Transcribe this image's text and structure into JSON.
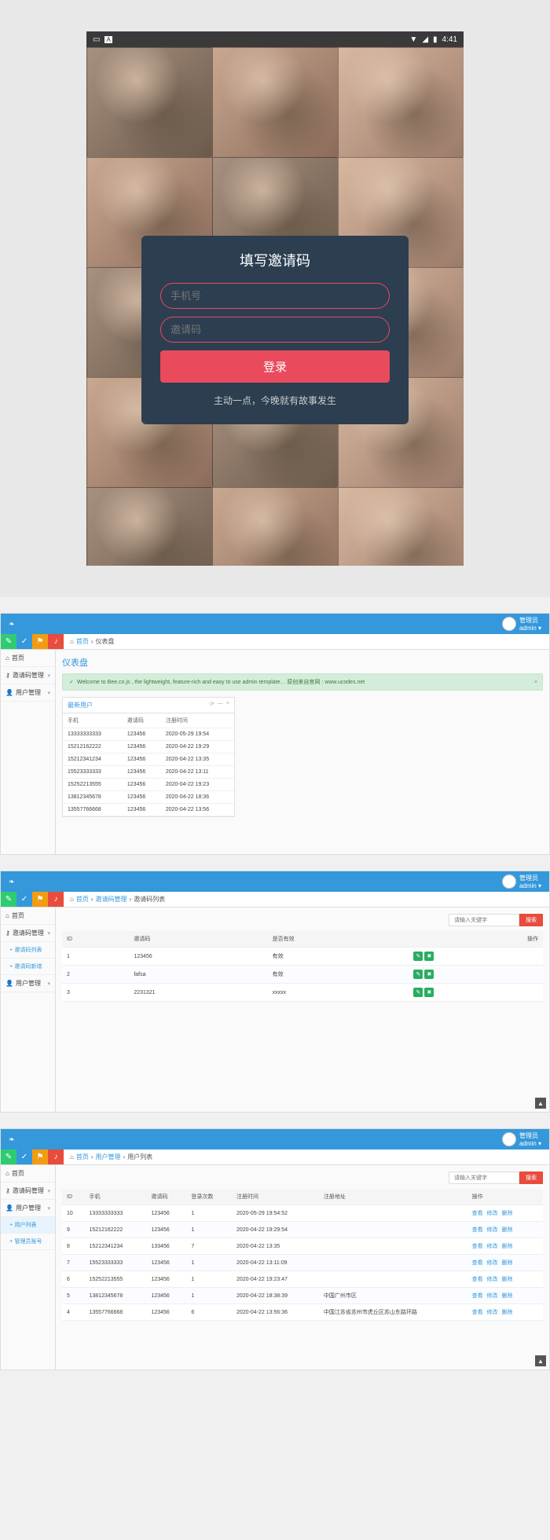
{
  "mobile": {
    "status_time": "4:41",
    "login_title": "填写邀请码",
    "phone_placeholder": "手机号",
    "code_placeholder": "邀请码",
    "login_btn": "登录",
    "tagline": "主动一点，今晚就有故事发生"
  },
  "panel1": {
    "user_label": "管理员\nadmin",
    "breadcrumb": [
      "首页",
      "仪表盘"
    ],
    "page_title": "仪表盘",
    "alert": "Welcome to Bee.cn.js , the lightweight, feature-rich and easy to use admin template… 原创来自官网 : www.ucodes.net",
    "sidebar": [
      {
        "label": "首页",
        "icon": "home"
      },
      {
        "label": "邀请码管理",
        "icon": "code",
        "expand": true
      },
      {
        "label": "用户管理",
        "icon": "user",
        "expand": true
      }
    ],
    "card_title": "最新用户",
    "table_headers": [
      "手机",
      "邀请码",
      "注册时间"
    ],
    "rows": [
      [
        "13333333333",
        "123456",
        "2020-05-29 19:54"
      ],
      [
        "15212162222",
        "123456",
        "2020-04-22 19:29"
      ],
      [
        "15212341234",
        "123456",
        "2020-04-22 13:35"
      ],
      [
        "15523333333",
        "123456",
        "2020-04-22 13:11"
      ],
      [
        "15252213555",
        "123456",
        "2020-04-22 19:23"
      ],
      [
        "13812345678",
        "123456",
        "2020-04-22 18:36"
      ],
      [
        "13557766668",
        "123456",
        "2020-04-22 13:56"
      ]
    ]
  },
  "panel2": {
    "breadcrumb": [
      "首页",
      "邀请码管理",
      "邀请码列表"
    ],
    "search_placeholder": "请输入关键字",
    "search_btn": "搜索",
    "sidebar": [
      {
        "label": "首页",
        "icon": "home"
      },
      {
        "label": "邀请码管理",
        "icon": "code",
        "expand": true
      },
      {
        "label": "邀请码列表",
        "sub": true
      },
      {
        "label": "邀请码新增",
        "sub": true
      },
      {
        "label": "用户管理",
        "icon": "user",
        "expand": true
      }
    ],
    "table_headers": [
      "ID",
      "邀请码",
      "是否有效",
      "操作"
    ],
    "rows": [
      {
        "id": "1",
        "code": "123456",
        "valid": "有效",
        "ops": true
      },
      {
        "id": "2",
        "code": "fafsa",
        "valid": "有效",
        "ops": true
      },
      {
        "id": "3",
        "code": "2231321",
        "valid": "xxxxx",
        "ops": true
      }
    ]
  },
  "panel3": {
    "breadcrumb": [
      "首页",
      "用户管理",
      "用户列表"
    ],
    "search_placeholder": "请输入关键字",
    "search_btn": "搜索",
    "sidebar": [
      {
        "label": "首页",
        "icon": "home"
      },
      {
        "label": "邀请码管理",
        "icon": "code",
        "expand": true
      },
      {
        "label": "用户管理",
        "icon": "user",
        "expand": true
      },
      {
        "label": "用户列表",
        "sub": true,
        "active": true
      },
      {
        "label": "管理员账号",
        "sub": true
      }
    ],
    "table_headers": [
      "ID",
      "手机",
      "邀请码",
      "登录次数",
      "注册时间",
      "注册地址",
      "操作"
    ],
    "op_labels": [
      "查看",
      "修改",
      "删除"
    ],
    "rows": [
      [
        "10",
        "13333333333",
        "123456",
        "1",
        "2020-05-29 19:54:52",
        "",
        true
      ],
      [
        "9",
        "15212162222",
        "123456",
        "1",
        "2020-04-22 19:29:54",
        "",
        true
      ],
      [
        "8",
        "15212341234",
        "133456",
        "7",
        "2020-04-22 13:35",
        "",
        true
      ],
      [
        "7",
        "15523333333",
        "123456",
        "1",
        "2020-04-22 13:11:09",
        "",
        true
      ],
      [
        "6",
        "15252213555",
        "123456",
        "1",
        "2020-04-22 19:23:47",
        "",
        true
      ],
      [
        "5",
        "13812345678",
        "123456",
        "1",
        "2020-04-22 18:38:39",
        "中国广州市区",
        true
      ],
      [
        "4",
        "13557766668",
        "123456",
        "6",
        "2020-04-22 13:56:36",
        "中国江苏省苏州市虎丘区苏山东路环路",
        true
      ]
    ]
  }
}
